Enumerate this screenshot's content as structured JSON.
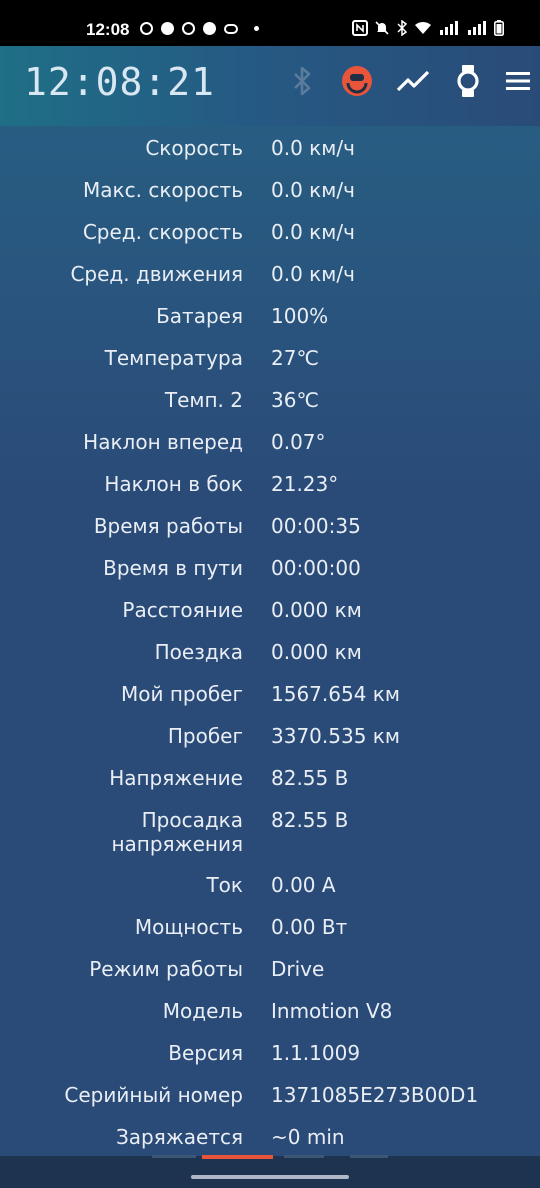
{
  "status_bar": {
    "time": "12:08",
    "left_icons": [
      "whatsapp-icon",
      "facebook-icon",
      "threads-icon",
      "app-icon",
      "oval-icon",
      "dot-icon"
    ],
    "right_icons": [
      "nfc-icon",
      "mute-icon",
      "bluetooth-icon",
      "wifi-icon",
      "signal-icon",
      "signal-icon",
      "battery-icon"
    ]
  },
  "app_bar": {
    "clock": "12:08:21",
    "icons": [
      "bluetooth-icon",
      "wheel-icon",
      "chart-icon",
      "watch-icon",
      "menu-icon"
    ],
    "accent_color": "#e8553a"
  },
  "rows": [
    {
      "label": "Скорость",
      "value": "0.0 км/ч"
    },
    {
      "label": "Макс. скорость",
      "value": "0.0 км/ч"
    },
    {
      "label": "Сред. скорость",
      "value": "0.0 км/ч"
    },
    {
      "label": "Сред. движения",
      "value": "0.0 км/ч"
    },
    {
      "label": "Батарея",
      "value": "100%"
    },
    {
      "label": "Температура",
      "value": "27℃"
    },
    {
      "label": "Темп. 2",
      "value": "36℃"
    },
    {
      "label": "Наклон вперед",
      "value": "0.07°"
    },
    {
      "label": "Наклон в бок",
      "value": "21.23°"
    },
    {
      "label": "Время работы",
      "value": "00:00:35"
    },
    {
      "label": "Время в пути",
      "value": "00:00:00"
    },
    {
      "label": "Расстояние",
      "value": "0.000 км"
    },
    {
      "label": "Поездка",
      "value": "0.000 км"
    },
    {
      "label": "Мой пробег",
      "value": "1567.654 км"
    },
    {
      "label": "Пробег",
      "value": "3370.535 км"
    },
    {
      "label": "Напряжение",
      "value": "82.55 В"
    },
    {
      "label": "Просадка напряжения",
      "value": "82.55 В"
    },
    {
      "label": "Ток",
      "value": "0.00 А"
    },
    {
      "label": "Мощность",
      "value": "0.00 Вт"
    },
    {
      "label": "Режим работы",
      "value": "Drive"
    },
    {
      "label": "Модель",
      "value": "Inmotion V8"
    },
    {
      "label": "Версия",
      "value": "1.1.1009"
    },
    {
      "label": "Серийный номер",
      "value": "1371085E273B00D1"
    },
    {
      "label": "Заряжается",
      "value": "~0 min"
    }
  ]
}
